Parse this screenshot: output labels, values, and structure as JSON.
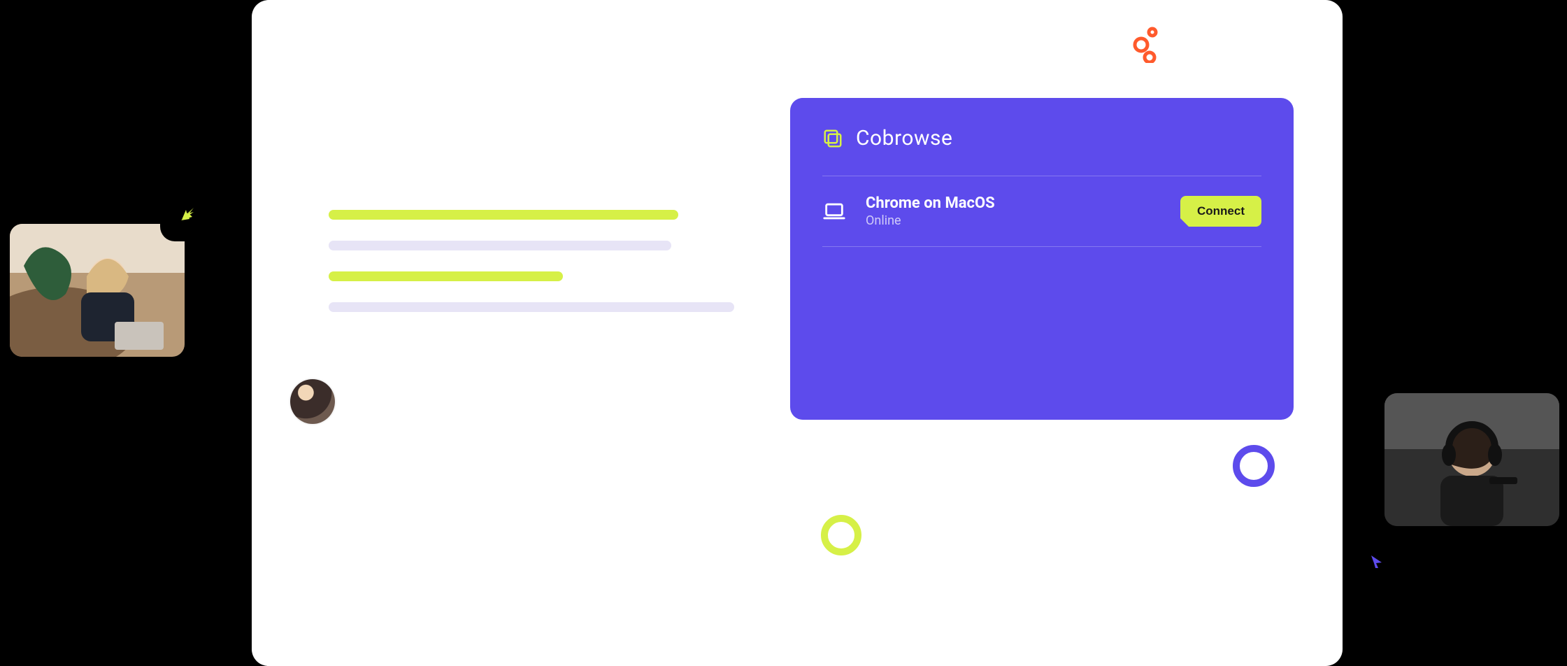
{
  "cobrowse": {
    "title": "Cobrowse",
    "session": {
      "name": "Chrome on MacOS",
      "status": "Online",
      "connect_label": "Connect"
    }
  },
  "colors": {
    "accent_purple": "#5d4bec",
    "accent_green": "#d6f047",
    "accent_orange": "#ff5a2c"
  },
  "icons": {
    "cobrowse_logo": "cobrowse-logo-icon",
    "laptop": "laptop-icon",
    "cursor_green": "cursor-arrow-green-icon",
    "cursor_purple": "cursor-arrow-purple-icon",
    "ring_purple": "ring-purple-icon",
    "ring_green": "ring-green-icon",
    "deco_orange": "deco-orange-icon"
  },
  "thumbnails": {
    "left_alt": "Customer on laptop",
    "right_alt": "Support agent with headset"
  }
}
